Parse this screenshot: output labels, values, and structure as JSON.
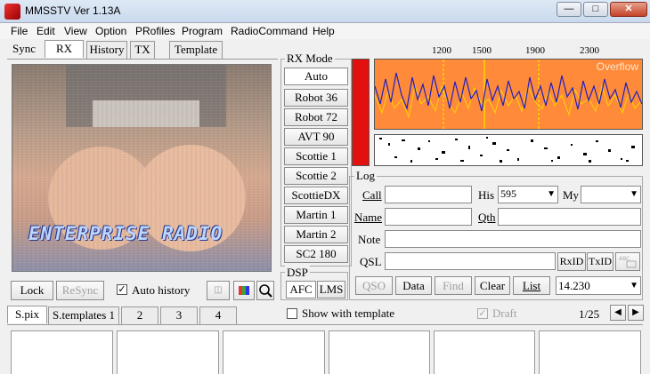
{
  "window": {
    "title": "MMSSTV Ver 1.13A"
  },
  "menu": [
    "File",
    "Edit",
    "View",
    "Option",
    "PRofiles",
    "Program",
    "RadioCommand",
    "Help"
  ],
  "tabs": [
    "Sync",
    "RX",
    "History",
    "TX",
    "Template"
  ],
  "picture": {
    "overlay_text": "ENTERPRISE RADIO"
  },
  "rx_controls": {
    "lock": "Lock",
    "resync": "ReSync",
    "auto_history": "Auto history",
    "auto_history_checked": true
  },
  "rx_mode": {
    "label": "RX Mode",
    "modes": [
      "Auto",
      "Robot 36",
      "Robot 72",
      "AVT 90",
      "Scottie 1",
      "Scottie 2",
      "ScottieDX",
      "Martin 1",
      "Martin 2",
      "SC2 180"
    ]
  },
  "dsp": {
    "label": "DSP",
    "afc": "AFC",
    "lms": "LMS"
  },
  "spectrum": {
    "ticks": [
      "1200",
      "1500",
      "1900",
      "2300"
    ],
    "status": "Overflow"
  },
  "log": {
    "label": "Log",
    "call_label": "Call",
    "call_value": "",
    "his_label": "His",
    "his_value": "595",
    "my_label": "My",
    "my_value": "",
    "name_label": "Name",
    "name_value": "",
    "qth_label": "Qth",
    "qth_value": "",
    "note_label": "Note",
    "note_value": "",
    "qsl_label": "QSL",
    "qsl_value": "",
    "rxid": "RxID",
    "txid": "TxID",
    "qso": "QSO",
    "data": "Data",
    "find": "Find",
    "clear": "Clear",
    "list": "List",
    "frequency": "14.230"
  },
  "bottom_tabs": [
    "S.pix",
    "S.templates 1",
    "2",
    "3",
    "4"
  ],
  "bottom_controls": {
    "show_template": "Show with template",
    "draft": "Draft",
    "page": "1/25"
  }
}
